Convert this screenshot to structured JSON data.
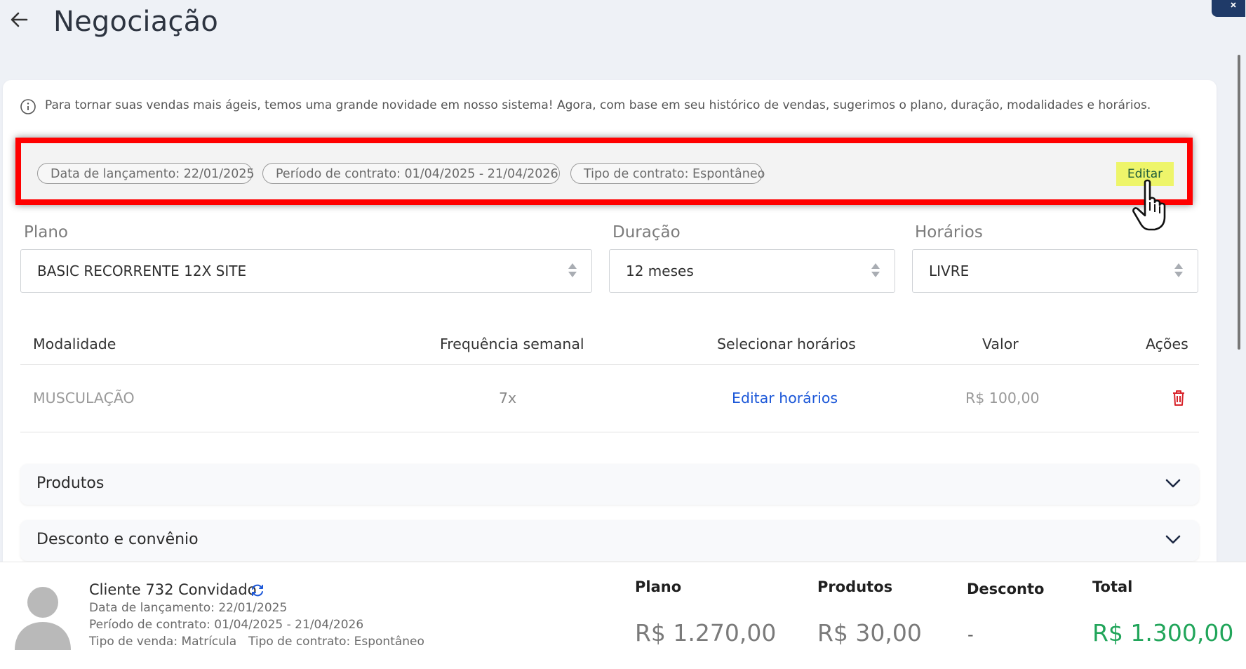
{
  "header": {
    "title": "Negociação"
  },
  "info_banner": {
    "text": "Para tornar suas vendas mais ágeis, temos uma grande novidade em nosso sistema! Agora, com base em seu histórico de vendas, sugerimos o plano, duração, modalidades e horários."
  },
  "summary_chips": {
    "data_lancamento": "Data de lançamento: 22/01/2025",
    "periodo_contrato": "Período de contrato: 01/04/2025 - 21/04/2026",
    "tipo_contrato": "Tipo de contrato: Espontâneo",
    "edit_label": "Editar"
  },
  "fields": {
    "plano": {
      "label": "Plano",
      "value": "BASIC RECORRENTE 12X SITE"
    },
    "duracao": {
      "label": "Duração",
      "value": "12 meses"
    },
    "horarios": {
      "label": "Horários",
      "value": "LIVRE"
    }
  },
  "table": {
    "headers": [
      "Modalidade",
      "Frequência semanal",
      "Selecionar horários",
      "Valor",
      "Ações"
    ],
    "rows": [
      {
        "modalidade": "MUSCULAÇÃO",
        "frequencia": "7x",
        "horarios_link": "Editar horários",
        "valor": "R$ 100,00"
      }
    ]
  },
  "accordions": [
    {
      "title": "Produtos"
    },
    {
      "title": "Desconto e convênio"
    }
  ],
  "footer": {
    "client_name": "Cliente 732 Convidado",
    "data_lancamento": "Data de lançamento: 22/01/2025",
    "periodo_contrato": "Período de contrato: 01/04/2025 - 21/04/2026",
    "tipo_venda": "Tipo de venda: Matrícula",
    "tipo_contrato": "Tipo de contrato: Espontâneo",
    "totals": {
      "plano_label": "Plano",
      "plano_value": "R$ 1.270,00",
      "produtos_label": "Produtos",
      "produtos_value": "R$ 30,00",
      "desconto_label": "Desconto",
      "desconto_value": "-",
      "total_label": "Total",
      "total_value": "R$ 1.300,00"
    }
  },
  "colors": {
    "accent_link": "#1b57d8",
    "total_green": "#21a55a",
    "highlight_red": "#ff0000",
    "edit_bg": "#eef56a",
    "danger": "#d8232a"
  },
  "icons": [
    "back-arrow-icon",
    "info-icon",
    "sort-arrows-icon",
    "trash-icon",
    "chevron-down-icon",
    "sync-icon",
    "avatar-icon",
    "pointer-hand-icon"
  ]
}
